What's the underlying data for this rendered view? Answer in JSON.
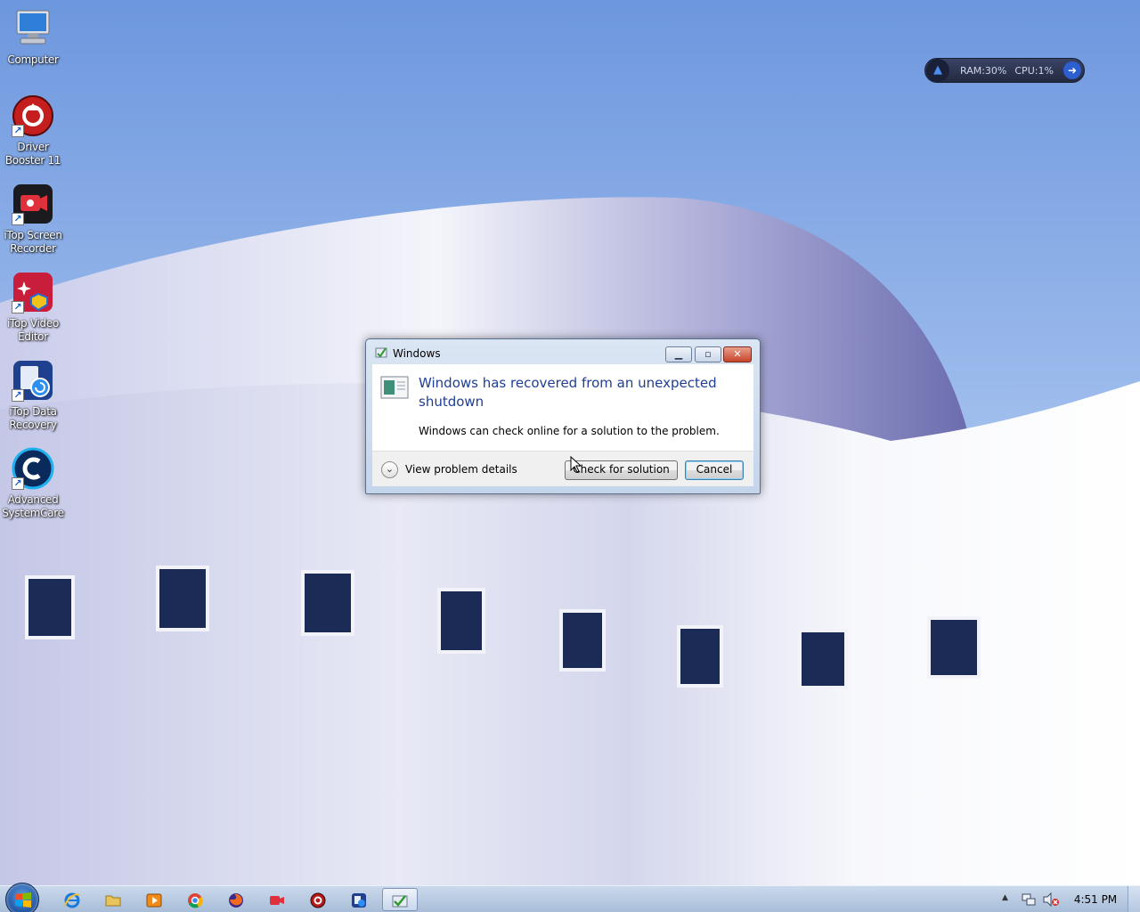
{
  "desktop": {
    "icons": [
      {
        "label": "Computer",
        "icon": "computer-icon"
      },
      {
        "label": "Driver Booster 11",
        "icon": "driver-booster-icon"
      },
      {
        "label": "iTop Screen Recorder",
        "icon": "itop-screen-recorder-icon"
      },
      {
        "label": "iTop Video Editor",
        "icon": "itop-video-editor-icon"
      },
      {
        "label": "iTop Data Recovery",
        "icon": "itop-data-recovery-icon"
      },
      {
        "label": "Advanced SystemCare",
        "icon": "advanced-systemcare-icon"
      }
    ]
  },
  "widget": {
    "ram": "RAM:30%",
    "cpu": "CPU:1%"
  },
  "dialog": {
    "title": "Windows",
    "main_instruction": "Windows has recovered from an unexpected shutdown",
    "content": "Windows can check online for a solution to the problem.",
    "details_label": "View problem details",
    "check_button": "Check for solution",
    "cancel_button": "Cancel"
  },
  "taskbar": {
    "apps": [
      "internet-explorer-icon",
      "file-explorer-icon",
      "media-player-icon",
      "chrome-icon",
      "firefox-icon",
      "screen-recorder-icon",
      "driver-booster-icon",
      "data-recovery-icon",
      "problem-reports-icon"
    ],
    "clock": "4:51 PM"
  },
  "colors": {
    "sky": "#7fa7e6",
    "dialog_title_text": "#1f3e96",
    "taskbar": "#b8cbe3"
  }
}
